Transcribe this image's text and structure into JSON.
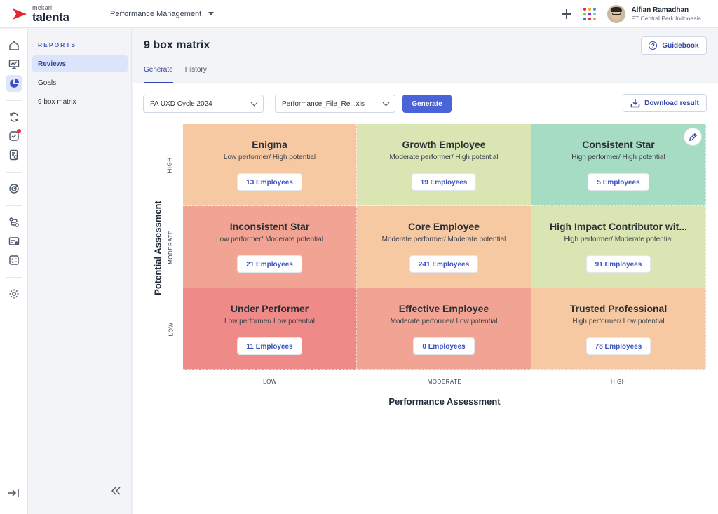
{
  "app": {
    "brand_top": "mekari",
    "brand_main": "talenta",
    "module": "Performance Management"
  },
  "user": {
    "name": "Alfian Ramadhan",
    "org": "PT Central Perk Indonesia"
  },
  "subnav": {
    "header": "REPORTS",
    "items": [
      {
        "label": "Reviews",
        "active": true
      },
      {
        "label": "Goals",
        "active": false
      },
      {
        "label": "9 box matrix",
        "active": false
      }
    ]
  },
  "page": {
    "title": "9 box matrix",
    "guidebook": "Guidebook",
    "tabs": [
      {
        "label": "Generate",
        "active": true
      },
      {
        "label": "History",
        "active": false
      }
    ],
    "cycle_select": "PA UXD Cycle 2024",
    "dash": "–",
    "file_select": "Performance_File_Re...xls",
    "generate": "Generate",
    "download": "Download result"
  },
  "matrix": {
    "y_label": "Potential Assessment",
    "x_label": "Performance Assessment",
    "y_ticks": [
      "HIGH",
      "MODERATE",
      "LOW"
    ],
    "x_ticks": [
      "LOW",
      "MODERATE",
      "HIGH"
    ],
    "cells": [
      {
        "title": "Enigma",
        "subtitle": "Low performer/ High potential",
        "count": "13 Employees",
        "color": "#f7c9a2"
      },
      {
        "title": "Growth Employee",
        "subtitle": "Moderate performer/ High potential",
        "count": "19 Employees",
        "color": "#d9e6b3"
      },
      {
        "title": "Consistent Star",
        "subtitle": "High performer/ High potential",
        "count": "5 Employees",
        "color": "#a6dcc4"
      },
      {
        "title": "Inconsistent Star",
        "subtitle": "Low performer/ Moderate potential",
        "count": "21 Employees",
        "color": "#f1a493"
      },
      {
        "title": "Core Employee",
        "subtitle": "Moderate performer/ Moderate potential",
        "count": "241 Employees",
        "color": "#f7c9a2"
      },
      {
        "title": "High Impact Contributor wit...",
        "subtitle": "High performer/ Moderate potential",
        "count": "91 Employees",
        "color": "#d9e6b3"
      },
      {
        "title": "Under Performer",
        "subtitle": "Low performer/ Low potential",
        "count": "11 Employees",
        "color": "#ee8a87"
      },
      {
        "title": "Effective Employee",
        "subtitle": "Moderate performer/ Low potential",
        "count": "0 Employees",
        "color": "#f1a493"
      },
      {
        "title": "Trusted Professional",
        "subtitle": "High performer/ Low potential",
        "count": "78 Employees",
        "color": "#f7c9a2"
      }
    ]
  },
  "colors": {
    "accent": "#4a63d9",
    "brand_red": "#e8262e",
    "active_nav": "#dce4fb"
  }
}
